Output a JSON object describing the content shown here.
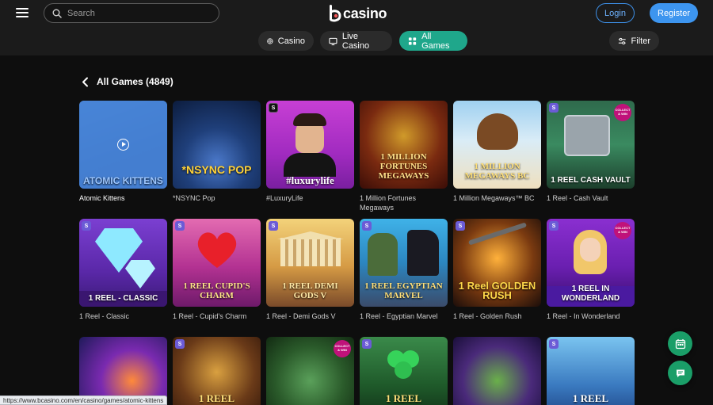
{
  "header": {
    "search_placeholder": "Search",
    "logo_text": "casino",
    "login_label": "Login",
    "register_label": "Register"
  },
  "nav": {
    "casino_label": "Casino",
    "live_casino_label": "Live Casino",
    "all_games_label": "All Games",
    "filter_label": "Filter"
  },
  "section": {
    "title": "All Games (4849)"
  },
  "games": [
    {
      "name": "Atomic Kittens"
    },
    {
      "name": "*NSYNC Pop"
    },
    {
      "name": "#LuxuryLife"
    },
    {
      "name": "1 Million Fortunes Megaways"
    },
    {
      "name": "1 Million Megaways™ BC"
    },
    {
      "name": "1 Reel - Cash Vault"
    },
    {
      "name": "1 Reel - Classic"
    },
    {
      "name": "1 Reel - Cupid's Charm"
    },
    {
      "name": "1 Reel - Demi Gods V"
    },
    {
      "name": "1 Reel - Egyptian Marvel"
    },
    {
      "name": "1 Reel - Golden Rush"
    },
    {
      "name": "1 Reel - In Wonderland"
    }
  ],
  "tile_art": {
    "atomic": "ATOMIC KITTENS",
    "nsync": "*NSYNC POP",
    "luxury": "#luxurylife",
    "fortunes": "1 MILLION FORTUNES MEGAWAYS",
    "megaways": "1 MILLION MEGAWAYS BC",
    "cash_vault": "1 REEL CASH VAULT",
    "classic": "1 REEL - CLASSIC",
    "cupid": "1 REEL CUPID'S CHARM",
    "demigods": "1 REEL DEMI GODS V",
    "egyptian": "1 REEL EGYPTIAN MARVEL",
    "golden": "1 Reel GOLDEN RUSH",
    "wonderland": "1 REEL IN WONDERLAND",
    "row3_bison": "1 REEL",
    "row3_clover": "1 REEL",
    "row3_ice": "1 REEL",
    "collect_win": "COLLECT & WIN",
    "provider_badge": "S"
  },
  "status_bar": {
    "url": "https://www.bcasino.com/en/casino/games/atomic-kittens"
  },
  "colors": {
    "accent_green": "#1fa78b",
    "register_blue": "#3d95ef",
    "float_green": "#1a9e68"
  },
  "icons": [
    "menu-icon",
    "search-icon",
    "globe-chip-icon",
    "live-tv-icon",
    "grid-icon",
    "filter-sliders-icon",
    "back-chevron-icon",
    "play-icon",
    "calendar-icon",
    "chat-icon"
  ]
}
